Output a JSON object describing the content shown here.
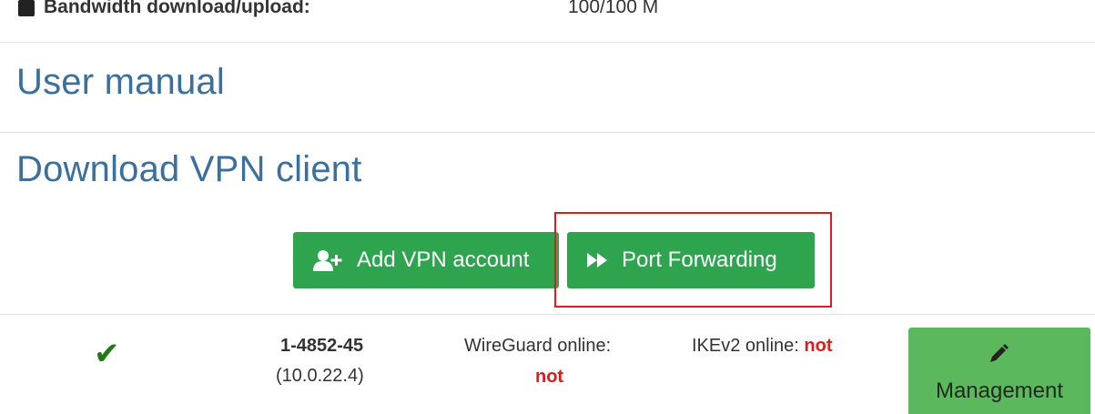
{
  "info_row": {
    "label": "Bandwidth download/upload:",
    "value": "100/100 M"
  },
  "sections": {
    "user_manual": "User manual",
    "download_client": "Download VPN client"
  },
  "actions": {
    "add_account": "Add VPN account",
    "port_forwarding": "Port Forwarding",
    "highlight_color": "#e01b1b"
  },
  "account": {
    "status_icon": "check-icon",
    "id": "1-4852-45",
    "ip": "(10.0.22.4)",
    "wireguard_label": "WireGuard online:",
    "wireguard_status": "not",
    "ikev2_label": "IKEv2 online:",
    "ikev2_status": "not",
    "management_label": "Management"
  },
  "colors": {
    "primary_green": "#2ea44f",
    "management_green": "#5cb85c",
    "title_blue": "#3a6f9e",
    "status_red": "#e01b1b"
  }
}
